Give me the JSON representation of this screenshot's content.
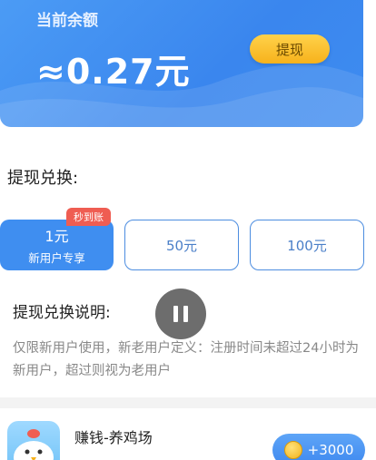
{
  "balance": {
    "label": "当前余额",
    "amount": "≈0.27元",
    "withdraw_label": "提现"
  },
  "exchange": {
    "title": "提现兑换:",
    "badge": "秒到账",
    "options": [
      {
        "amount": "1元",
        "sub": "新用户专享",
        "selected": true
      },
      {
        "amount": "50元",
        "selected": false
      },
      {
        "amount": "100元",
        "selected": false
      }
    ]
  },
  "explanation": {
    "title": "提现兑换说明:",
    "text": "仅限新用户使用，新老用户定义：注册时间未超过24小时为新用户，超过则视为老用户"
  },
  "task": {
    "title": "赚钱-养鸡场",
    "reward": "+3000"
  },
  "colors": {
    "primary": "#3f8ef0",
    "accent": "#f7b21c",
    "badge": "#ef5d52"
  }
}
